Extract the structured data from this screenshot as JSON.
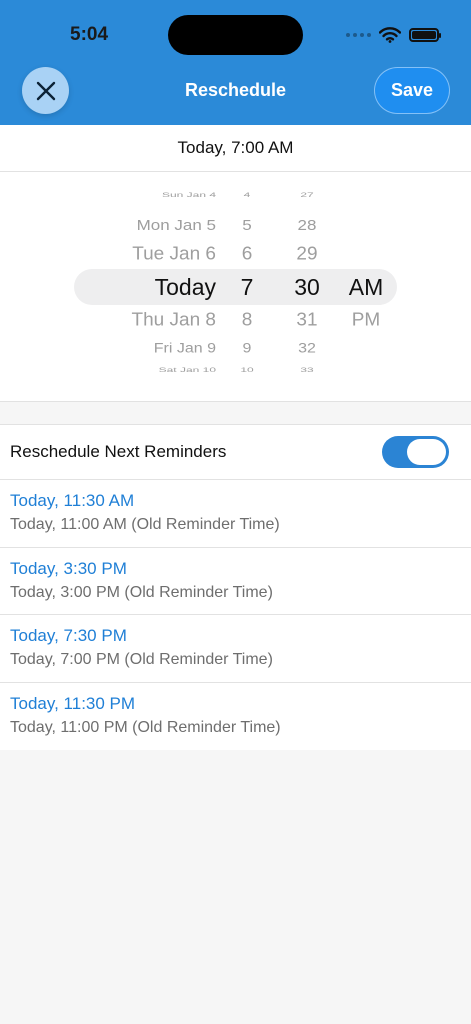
{
  "status_bar": {
    "time": "5:04"
  },
  "header": {
    "title": "Reschedule",
    "save_label": "Save"
  },
  "selected_datetime": "Today, 7:00 AM",
  "picker": {
    "dates": [
      "Sun Jan 4",
      "Mon Jan 5",
      "Tue Jan 6",
      "Today",
      "Thu Jan 8",
      "Fri Jan 9",
      "Sat Jan 10"
    ],
    "hours": [
      "4",
      "5",
      "6",
      "7",
      "8",
      "9",
      "10"
    ],
    "minutes": [
      "27",
      "28",
      "29",
      "30",
      "31",
      "32",
      "33"
    ],
    "periods": [
      "AM",
      "PM"
    ]
  },
  "reschedule_toggle": {
    "label": "Reschedule Next Reminders",
    "on": true
  },
  "reminders": [
    {
      "new_time": "Today, 11:30 AM",
      "old_time": "Today, 11:00 AM (Old Reminder Time)"
    },
    {
      "new_time": "Today, 3:30 PM",
      "old_time": "Today, 3:00 PM (Old Reminder Time)"
    },
    {
      "new_time": "Today, 7:30 PM",
      "old_time": "Today, 7:00 PM (Old Reminder Time)"
    },
    {
      "new_time": "Today, 11:30 PM",
      "old_time": "Today, 11:00 PM (Old Reminder Time)"
    }
  ],
  "colors": {
    "header": "#2b8ad8",
    "accent": "#1f7fd6",
    "save_button": "#1f8ef0",
    "toggle_on": "#2b84d4"
  },
  "icons": {
    "close": "close-icon",
    "wifi": "wifi-icon",
    "battery": "battery-icon",
    "signal": "signal-icon"
  }
}
